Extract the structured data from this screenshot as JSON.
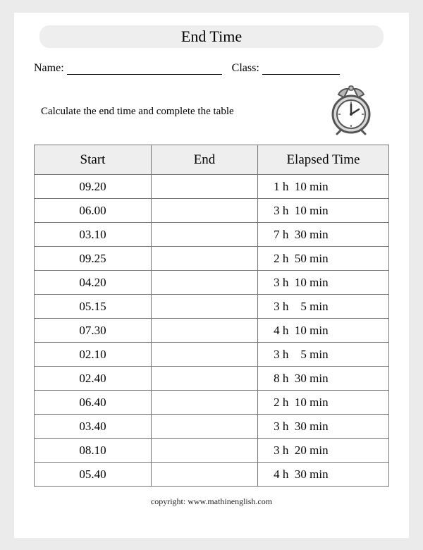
{
  "title": "End Time",
  "labels": {
    "name": "Name:",
    "class": "Class:"
  },
  "instruction": "Calculate the end time and complete the table",
  "columns": {
    "start": "Start",
    "end": "End",
    "elapsed": "Elapsed Time"
  },
  "rows": [
    {
      "start": "09.20",
      "end": "",
      "elapsed": " 1 h  10 min"
    },
    {
      "start": "06.00",
      "end": "",
      "elapsed": " 3 h  10 min"
    },
    {
      "start": "03.10",
      "end": "",
      "elapsed": " 7 h  30 min"
    },
    {
      "start": "09.25",
      "end": "",
      "elapsed": " 2 h  50 min"
    },
    {
      "start": "04.20",
      "end": "",
      "elapsed": " 3 h  10 min"
    },
    {
      "start": "05.15",
      "end": "",
      "elapsed": " 3 h    5 min"
    },
    {
      "start": "07.30",
      "end": "",
      "elapsed": " 4 h  10 min"
    },
    {
      "start": "02.10",
      "end": "",
      "elapsed": " 3 h    5 min"
    },
    {
      "start": "02.40",
      "end": "",
      "elapsed": " 8 h  30 min"
    },
    {
      "start": "06.40",
      "end": "",
      "elapsed": " 2 h  10 min"
    },
    {
      "start": "03.40",
      "end": "",
      "elapsed": " 3 h  30 min"
    },
    {
      "start": "08.10",
      "end": "",
      "elapsed": " 3 h  20 min"
    },
    {
      "start": "05.40",
      "end": "",
      "elapsed": " 4 h  30 min"
    }
  ],
  "footer": "copyright:    www.mathinenglish.com"
}
